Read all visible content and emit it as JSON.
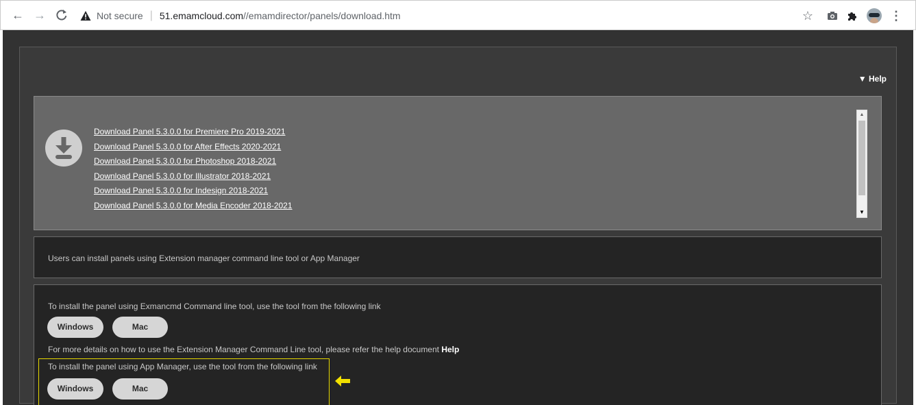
{
  "browser": {
    "security_label": "Not secure",
    "url_host": "51.emamcloud.com",
    "url_path": "//emamdirector/panels/download.htm",
    "icons": [
      "back-arrow-icon",
      "forward-arrow-icon",
      "reload-icon",
      "warning-icon",
      "star-icon",
      "camera-icon",
      "puzzle-icon",
      "profile-avatar",
      "menu-dots-icon"
    ]
  },
  "help": {
    "label": "▼ Help"
  },
  "downloads": {
    "icon": "download-icon",
    "links": [
      "Download Panel 5.3.0.0 for Premiere Pro 2019-2021",
      "Download Panel 5.3.0.0 for After Effects 2020-2021",
      "Download Panel 5.3.0.0 for Photoshop 2018-2021",
      "Download Panel 5.3.0.0 for Illustrator 2018-2021",
      "Download Panel 5.3.0.0 for Indesign 2018-2021",
      "Download Panel 5.3.0.0 for Media Encoder 2018-2021"
    ]
  },
  "info": {
    "text": "Users can install panels using Extension manager command line tool or App Manager"
  },
  "install": {
    "exman_text": "To install the panel using Exmancmd Command line tool, use the tool from the following link",
    "exman_windows": "Windows",
    "exman_mac": "Mac",
    "details_text": "For more details on how to use the Extension Manager Command Line tool, please refer the help document",
    "details_help": "Help",
    "app_text": "To install the panel using App Manager, use the tool from the following link",
    "app_windows": "Windows",
    "app_mac": "Mac"
  },
  "colors": {
    "page_bg": "#323232",
    "downloads_bg": "#686868",
    "highlight": "#e6d800"
  }
}
